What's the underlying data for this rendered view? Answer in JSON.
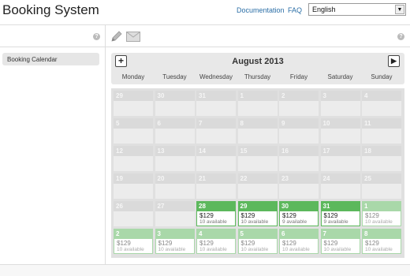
{
  "app": {
    "title": "Booking System"
  },
  "header": {
    "links": [
      "Documentation",
      "FAQ"
    ],
    "language": {
      "selected": "English"
    }
  },
  "icons": {
    "help": "question-icon",
    "edit": "pencil-icon",
    "mail": "envelope-icon",
    "prev": "plus-icon",
    "next": "play-icon"
  },
  "sidebar": {
    "items": [
      {
        "label": "Booking Calendar"
      }
    ]
  },
  "calendar": {
    "month_title": "August 2013",
    "prev_symbol": "+",
    "next_symbol": "▶",
    "days": [
      "Monday",
      "Tuesday",
      "Wednesday",
      "Thursday",
      "Friday",
      "Saturday",
      "Sunday"
    ],
    "cells": [
      {
        "d": "29",
        "s": "dis"
      },
      {
        "d": "30",
        "s": "dis"
      },
      {
        "d": "31",
        "s": "dis"
      },
      {
        "d": "1",
        "s": "dis"
      },
      {
        "d": "2",
        "s": "dis"
      },
      {
        "d": "3",
        "s": "dis"
      },
      {
        "d": "4",
        "s": "dis"
      },
      {
        "d": "5",
        "s": "dis"
      },
      {
        "d": "6",
        "s": "dis"
      },
      {
        "d": "7",
        "s": "dis"
      },
      {
        "d": "8",
        "s": "dis"
      },
      {
        "d": "9",
        "s": "dis"
      },
      {
        "d": "10",
        "s": "dis"
      },
      {
        "d": "11",
        "s": "dis"
      },
      {
        "d": "12",
        "s": "dis"
      },
      {
        "d": "13",
        "s": "dis"
      },
      {
        "d": "14",
        "s": "dis"
      },
      {
        "d": "15",
        "s": "dis"
      },
      {
        "d": "16",
        "s": "dis"
      },
      {
        "d": "17",
        "s": "dis"
      },
      {
        "d": "18",
        "s": "dis"
      },
      {
        "d": "19",
        "s": "dis"
      },
      {
        "d": "20",
        "s": "dis"
      },
      {
        "d": "21",
        "s": "dis"
      },
      {
        "d": "22",
        "s": "dis"
      },
      {
        "d": "23",
        "s": "dis"
      },
      {
        "d": "24",
        "s": "dis"
      },
      {
        "d": "25",
        "s": "dis"
      },
      {
        "d": "26",
        "s": "dis"
      },
      {
        "d": "27",
        "s": "dis"
      },
      {
        "d": "28",
        "s": "av",
        "price": "$129",
        "avail": "10 available"
      },
      {
        "d": "29",
        "s": "av",
        "price": "$129",
        "avail": "10 available"
      },
      {
        "d": "30",
        "s": "av",
        "price": "$129",
        "avail": "9 available"
      },
      {
        "d": "31",
        "s": "av",
        "price": "$129",
        "avail": "9 available"
      },
      {
        "d": "1",
        "s": "nx",
        "price": "$129",
        "avail": "10 available"
      },
      {
        "d": "2",
        "s": "nx",
        "price": "$129",
        "avail": "10 available"
      },
      {
        "d": "3",
        "s": "nx",
        "price": "$129",
        "avail": "10 available"
      },
      {
        "d": "4",
        "s": "nx",
        "price": "$129",
        "avail": "10 available"
      },
      {
        "d": "5",
        "s": "nx",
        "price": "$129",
        "avail": "10 available"
      },
      {
        "d": "6",
        "s": "nx",
        "price": "$129",
        "avail": "10 available"
      },
      {
        "d": "7",
        "s": "nx",
        "price": "$129",
        "avail": "10 available"
      },
      {
        "d": "8",
        "s": "nx",
        "price": "$129",
        "avail": "10 available"
      }
    ]
  },
  "colors": {
    "available": "#5cb85c",
    "next_month": "#a9d8a9",
    "disabled": "#dadada",
    "link": "#2a6ea6"
  }
}
